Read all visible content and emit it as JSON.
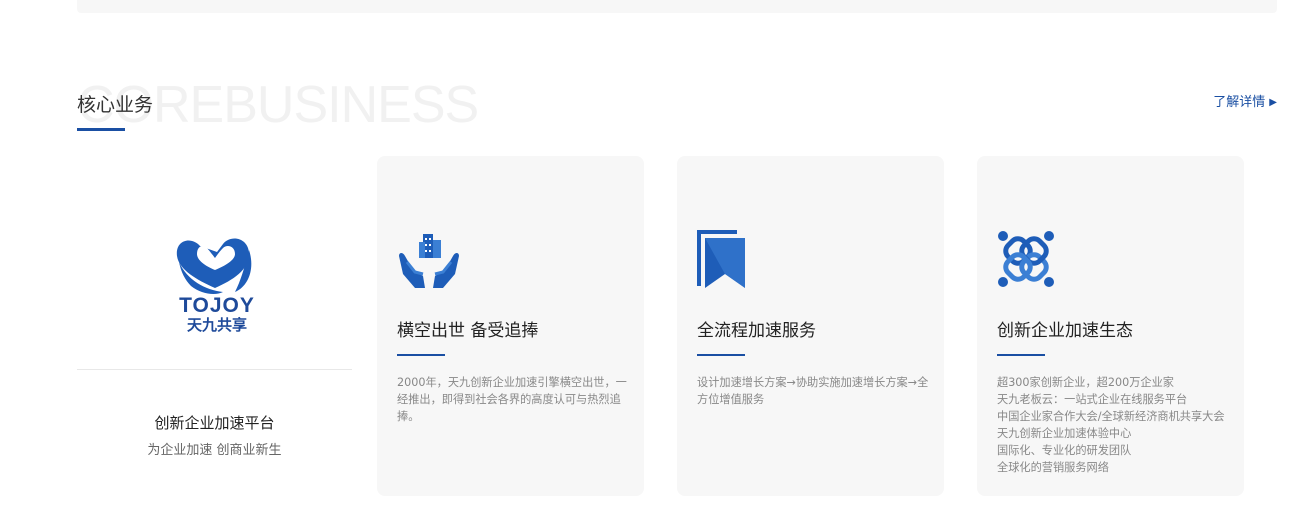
{
  "section": {
    "watermark": "COREBUSINESS",
    "title": "核心业务",
    "more_label": "了解详情",
    "more_arrow": "▶"
  },
  "brand": {
    "logo_text_en": "TOJOY",
    "logo_text_cn": "天九共享",
    "title": "创新企业加速平台",
    "subtitle": "为企业加速 创商业新生"
  },
  "cards": [
    {
      "icon": "hands-building-icon",
      "title": "横空出世 备受追捧",
      "desc": [
        "2000年，天九创新企业加速引擎横空出世，一经推出，即得到社会各界的高度认可与热烈追捧。"
      ]
    },
    {
      "icon": "bookmark-icon",
      "title": "全流程加速服务",
      "desc": [
        "设计加速增长方案→协助实施加速增长方案→全方位增值服务"
      ]
    },
    {
      "icon": "network-link-icon",
      "title": "创新企业加速生态",
      "desc": [
        "超300家创新企业，超200万企业家",
        "天九老板云：一站式企业在线服务平台",
        "中国企业家合作大会/全球新经济商机共享大会",
        "天九创新企业加速体验中心",
        "国际化、专业化的研发团队",
        "全球化的营销服务网络"
      ]
    }
  ],
  "colors": {
    "accent": "#1a4fa3",
    "card_bg": "#f7f7f7",
    "icon_blue": "#1e5db8"
  }
}
